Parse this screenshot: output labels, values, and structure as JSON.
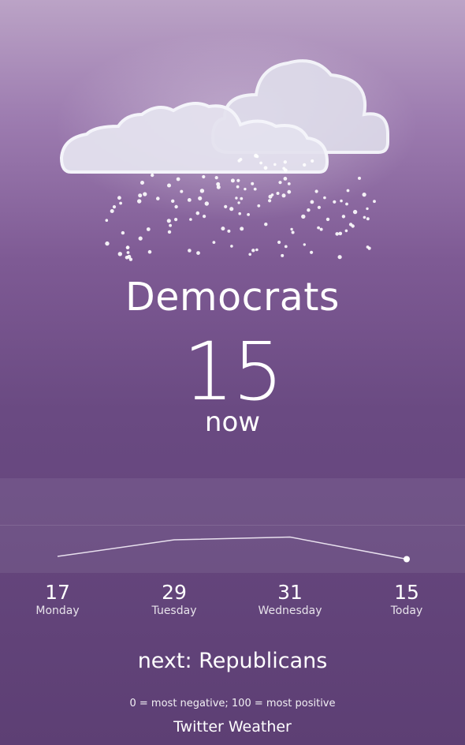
{
  "condition": {
    "icon": "rain-cloud-icon",
    "category": "Democrats",
    "score": "15",
    "score_unit": "now"
  },
  "chart_data": {
    "type": "line",
    "categories": [
      "Monday",
      "Tuesday",
      "Wednesday",
      "Today"
    ],
    "values": [
      17,
      29,
      31,
      15
    ]
  },
  "forecast": [
    {
      "value": "17",
      "day": "Monday"
    },
    {
      "value": "29",
      "day": "Tuesday"
    },
    {
      "value": "31",
      "day": "Wednesday"
    },
    {
      "value": "15",
      "day": "Today"
    }
  ],
  "next": "next: Republicans",
  "legend": "0 = most negative; 100 = most positive",
  "brand": "Twitter Weather",
  "colors": {
    "bg_top": "#bba3c6",
    "bg_bottom": "#5d3f74",
    "cloud": "#e4e2ee"
  }
}
